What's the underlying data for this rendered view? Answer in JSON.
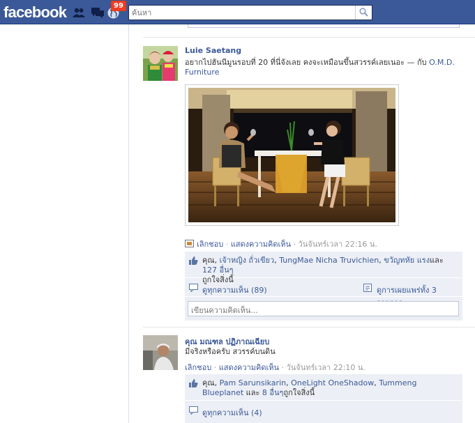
{
  "topbar": {
    "logo": "facebook",
    "notification_count": "99",
    "search_placeholder": "ค้นหา"
  },
  "posts": [
    {
      "author": "Luie Saetang",
      "message": "อยากไปฮันนีมูนรอบที่ 20 ที่นี่จังเลย คงจะเหมือนขึ้นสวรรค์เลยเนอะ",
      "with_sep": " — กับ ",
      "with_tag": "O.M.D. Furniture",
      "unlike": "เลิกชอบ",
      "comment": "แสดงความคิดเห็น",
      "time": "วันจันทร์เวลา 22:16 น.",
      "likes_prefix": "คุณ, ",
      "liker1": "เจ้าหญิง ถั่วเขียว",
      "liker_sep": ", ",
      "liker2": "TungMae Nicha Truvichien",
      "liker3": "ขวัญทหัย แรง",
      "likes_and": "และ ",
      "likes_more": "127 อื่นๆ",
      "likes_suffix": "ถูกใจสิ่งนี้",
      "view_comments": "ดูทุกความเห็น (89)",
      "view_shares": "ดูการเผยแพร่ทั้ง 3 รายการ",
      "comment_placeholder": "เขียนความคิดเห็น..."
    },
    {
      "author": "คุณ มณฑล ปฏิภาณเฉียบ",
      "message": "มีจริงหรือครับ สวรรค์บนดิน",
      "unlike": "เลิกชอบ",
      "comment": "แสดงความคิดเห็น",
      "time": "วันจันทร์เวลา 22:10 น.",
      "likes_prefix": "คุณ, ",
      "liker1": "Pam Sarunsikarin",
      "liker_sep": ", ",
      "liker2": "OneLight OneShadow",
      "liker3": "Tummeng Blueplanet",
      "likes_and": " และ ",
      "likes_more": "8 อื่นๆ",
      "likes_suffix": "ถูกใจสิ่งนี้",
      "view_comments": "ดูทุกความเห็น (4)"
    }
  ],
  "colors": {
    "brand": "#3b5998",
    "ufi_bg": "#eceff5",
    "badge": "#f03d25"
  }
}
